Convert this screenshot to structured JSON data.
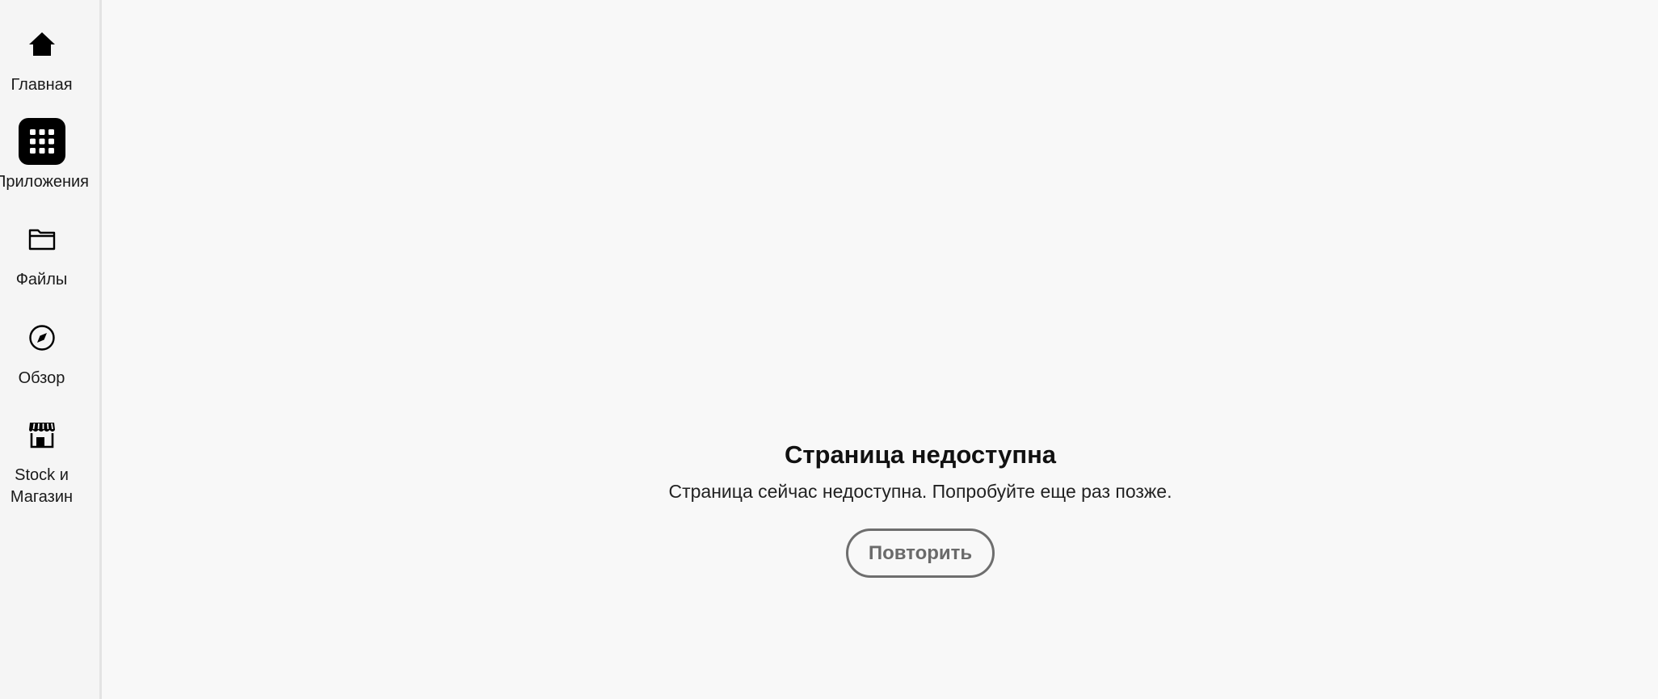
{
  "sidebar": {
    "items": [
      {
        "id": "home",
        "label": "Главная",
        "icon": "home-icon",
        "selected": false
      },
      {
        "id": "apps",
        "label": "Приложения",
        "icon": "apps-grid-icon",
        "selected": true
      },
      {
        "id": "files",
        "label": "Файлы",
        "icon": "folder-icon",
        "selected": false
      },
      {
        "id": "explore",
        "label": "Обзор",
        "icon": "compass-icon",
        "selected": false
      },
      {
        "id": "stock",
        "label": "Stock и Магазин",
        "icon": "storefront-icon",
        "selected": false
      }
    ]
  },
  "error": {
    "title": "Страница недоступна",
    "message": "Страница сейчас недоступна. Попробуйте еще раз позже.",
    "retry_label": "Повторить"
  },
  "colors": {
    "background": "#f8f8f8",
    "sidebar_background": "#f5f5f5",
    "selected_icon_background": "#000000",
    "button_border": "#6e6e6e"
  }
}
